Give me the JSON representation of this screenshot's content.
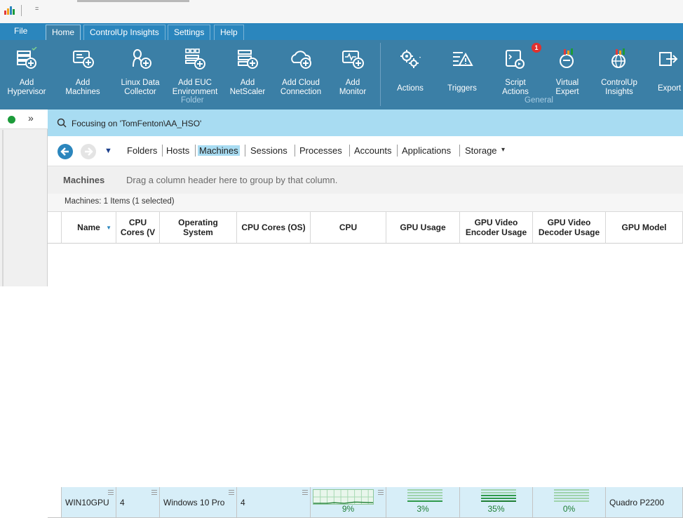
{
  "tabs": {
    "file": "File",
    "home": "Home",
    "insights": "ControlUp Insights",
    "settings": "Settings",
    "help": "Help"
  },
  "ribbon": {
    "buttons": [
      {
        "label": "Add\nHypervisor"
      },
      {
        "label": "Add\nMachines"
      },
      {
        "label": "Linux Data\nCollector"
      },
      {
        "label": "Add EUC\nEnvironment"
      },
      {
        "label": "Add\nNetScaler"
      },
      {
        "label": "Add Cloud\nConnection"
      },
      {
        "label": "Add\nMonitor"
      },
      {
        "label": "Actions"
      },
      {
        "label": "Triggers"
      },
      {
        "label": "Script\nActions"
      },
      {
        "label": "Virtual\nExpert"
      },
      {
        "label": "ControlUp\nInsights"
      },
      {
        "label": "Export"
      }
    ],
    "group_folder": "Folder",
    "group_general": "General",
    "script_badge": "1"
  },
  "focus": {
    "text": "Focusing on 'TomFenton\\AA_HSO'"
  },
  "nav": {
    "items": [
      "Folders",
      "Hosts",
      "Machines",
      "Sessions",
      "Processes",
      "Accounts",
      "Applications",
      "Storage"
    ],
    "storage_caret": "▾"
  },
  "grouping": {
    "title": "Machines",
    "hint": "Drag a column header here to group by that column."
  },
  "count": "Machines: 1 Items (1 selected)",
  "table": {
    "headers": [
      "Name",
      "CPU Cores (V",
      "Operating System",
      "CPU Cores (OS)",
      "CPU",
      "GPU Usage",
      "GPU Video Encoder Usage",
      "GPU Video Decoder Usage",
      "GPU Model"
    ],
    "row": {
      "name": "WIN10GPU",
      "cores_v": "4",
      "os": "Windows 10 Pro",
      "cores_os": "4",
      "cpu": "9%",
      "gpu_usage": "3%",
      "gpu_enc": "35%",
      "gpu_dec": "0%",
      "gpu_model": "Quadro P2200"
    }
  },
  "colors": {
    "ribbon": "#3b7fa6",
    "tabs": "#2b86bd",
    "focus": "#a8dcf2",
    "row": "#d7eef8",
    "status": "#1c9b3a"
  }
}
